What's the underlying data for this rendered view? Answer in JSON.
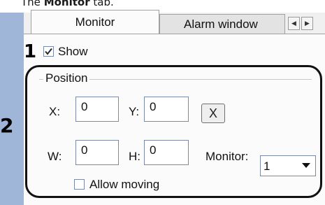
{
  "caption": {
    "prefix": "The",
    "bold": "Monitor",
    "suffix": "tab."
  },
  "tabs": [
    {
      "label": "Monitor"
    },
    {
      "label": "Alarm window"
    }
  ],
  "badges": {
    "one": "1",
    "two": "2"
  },
  "show": {
    "label": "Show",
    "checked": true
  },
  "position": {
    "title": "Position",
    "x_label": "X:",
    "x_value": "0",
    "y_label": "Y:",
    "y_value": "0",
    "clear_label": "X",
    "w_label": "W:",
    "w_value": "0",
    "h_label": "H:",
    "h_value": "0",
    "monitor_label": "Monitor:",
    "monitor_value": "1"
  },
  "allow_moving": {
    "label": "Allow moving",
    "checked": false
  },
  "icons": {
    "tab_left": "triangle-left-icon",
    "tab_right": "triangle-right-icon",
    "dropdown": "triangle-down-icon",
    "check": "checkmark-icon"
  },
  "colors": {
    "strip": "#9fb6d9",
    "highlight": "#111111"
  }
}
